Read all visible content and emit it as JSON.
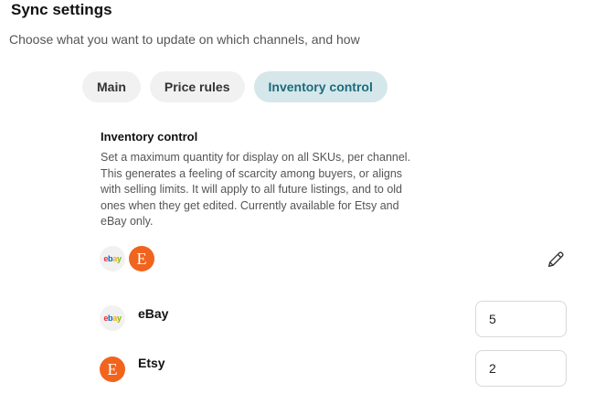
{
  "header": {
    "title": "Sync settings",
    "subtitle": "Choose what you want to update on which channels, and how"
  },
  "tabs": [
    {
      "label": "Main",
      "active": false
    },
    {
      "label": "Price rules",
      "active": false
    },
    {
      "label": "Inventory control",
      "active": true
    }
  ],
  "inventory": {
    "title": "Inventory control",
    "description": "Set a maximum quantity for display on all SKUs, per channel. This generates a feeling of scarcity among buyers, or aligns with selling limits. It will apply to all future listings, and to old ones when they get edited. Currently available for Etsy and eBay only.",
    "channels": [
      {
        "name": "eBay",
        "quantity": "5"
      },
      {
        "name": "Etsy",
        "quantity": "2"
      }
    ]
  },
  "logos": {
    "ebay_letters": [
      "e",
      "b",
      "a",
      "y"
    ],
    "etsy_letter": "E"
  },
  "icons": {
    "edit": "pencil-icon"
  },
  "colors": {
    "active_tab_bg": "#d5e7ea",
    "active_tab_text": "#1d6b7d",
    "etsy_orange": "#f1641e"
  }
}
